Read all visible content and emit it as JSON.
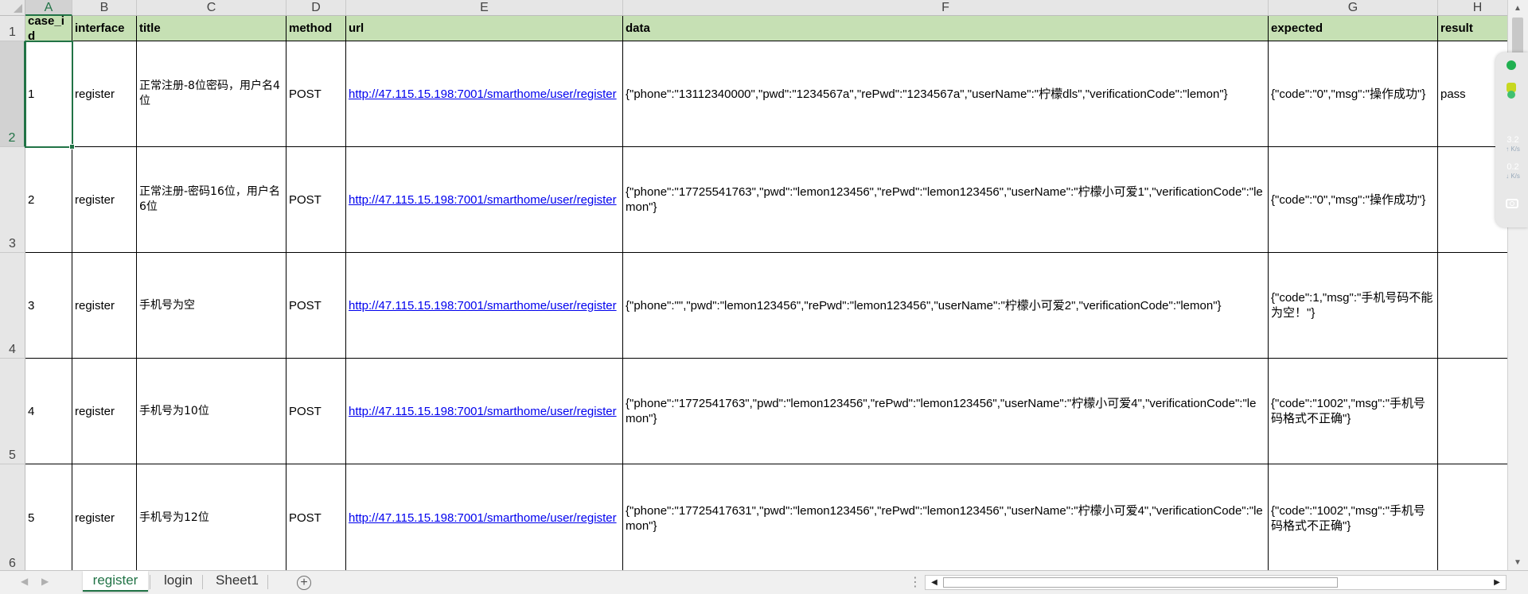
{
  "columns": [
    "A",
    "B",
    "C",
    "D",
    "E",
    "F",
    "G",
    "H"
  ],
  "row_numbers": [
    "1",
    "2",
    "3",
    "4",
    "5",
    "6"
  ],
  "headers": [
    "case_id",
    "interface",
    "title",
    "method",
    "url",
    "data",
    "expected",
    "result"
  ],
  "rows": [
    {
      "case_id": "1",
      "interface": "register",
      "title": "正常注册-8位密码，用户名4位",
      "method": "POST",
      "url": "http://47.115.15.198:7001/smarthome/user/register",
      "data": "{\"phone\":\"13112340000\",\"pwd\":\"1234567a\",\"rePwd\":\"1234567a\",\"userName\":\"柠檬dls\",\"verificationCode\":\"lemon\"}",
      "expected": "{\"code\":\"0\",\"msg\":\"操作成功\"}",
      "result": "pass"
    },
    {
      "case_id": "2",
      "interface": "register",
      "title": "正常注册-密码16位，用户名6位",
      "method": "POST",
      "url": "http://47.115.15.198:7001/smarthome/user/register",
      "data": "{\"phone\":\"17725541763\",\"pwd\":\"lemon123456\",\"rePwd\":\"lemon123456\",\"userName\":\"柠檬小可爱1\",\"verificationCode\":\"lemon\"}",
      "expected": "{\"code\":\"0\",\"msg\":\"操作成功\"}",
      "result": ""
    },
    {
      "case_id": "3",
      "interface": "register",
      "title": "手机号为空",
      "method": "POST",
      "url": "http://47.115.15.198:7001/smarthome/user/register",
      "data": "{\"phone\":\"\",\"pwd\":\"lemon123456\",\"rePwd\":\"lemon123456\",\"userName\":\"柠檬小可爱2\",\"verificationCode\":\"lemon\"}",
      "expected": "{\"code\":1,\"msg\":\"手机号码不能为空！\"}",
      "result": ""
    },
    {
      "case_id": "4",
      "interface": "register",
      "title": "手机号为10位",
      "method": "POST",
      "url": "http://47.115.15.198:7001/smarthome/user/register",
      "data": "{\"phone\":\"1772541763\",\"pwd\":\"lemon123456\",\"rePwd\":\"lemon123456\",\"userName\":\"柠檬小可爱4\",\"verificationCode\":\"lemon\"}",
      "expected": "{\"code\":\"1002\",\"msg\":\"手机号码格式不正确\"}",
      "result": ""
    },
    {
      "case_id": "5",
      "interface": "register",
      "title": "手机号为12位",
      "method": "POST",
      "url": "http://47.115.15.198:7001/smarthome/user/register",
      "data": "{\"phone\":\"17725417631\",\"pwd\":\"lemon123456\",\"rePwd\":\"lemon123456\",\"userName\":\"柠檬小可爱4\",\"verificationCode\":\"lemon\"}",
      "expected": "{\"code\":\"1002\",\"msg\":\"手机号码格式不正确\"}",
      "result": ""
    }
  ],
  "sheet_tabs": [
    "register",
    "login",
    "Sheet1"
  ],
  "active_tab": "register",
  "active_cell": "A2",
  "net_widget": {
    "upload_speed": "3.2",
    "download_speed": "0.2",
    "unit": "K/s"
  },
  "colors": {
    "header_fill": "#c6e0b4",
    "accent": "#217346",
    "link": "#0000ee",
    "widget_green": "#20b050",
    "widget_yellow": "#c8d820"
  }
}
